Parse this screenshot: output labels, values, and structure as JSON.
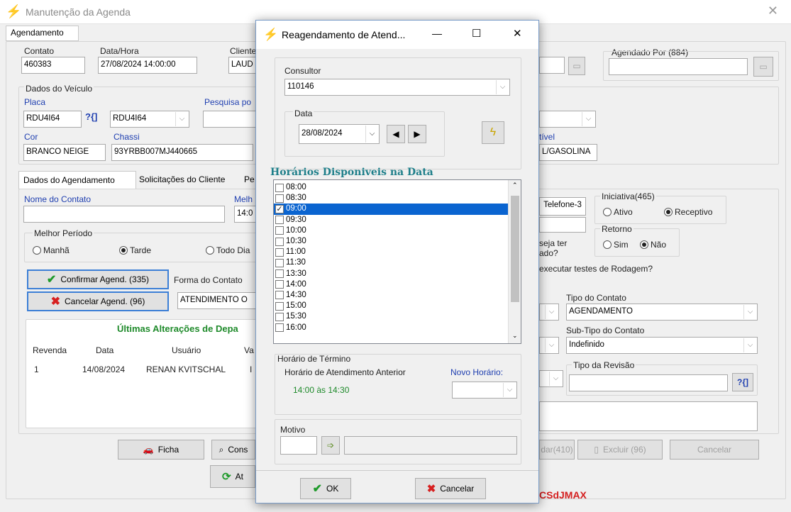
{
  "main": {
    "title": "Manutenção da Agenda",
    "close": "✕",
    "tab": "Agendamento",
    "contato_label": "Contato",
    "contato_value": "460383",
    "datahora_label": "Data/Hora",
    "datahora_value": "27/08/2024 14:00:00",
    "cliente_label": "Cliente",
    "cliente_value": "LAUD",
    "agendado_label": "Agendado Por (884)",
    "agendado_value": "",
    "veiculo_label": "Dados do Veículo",
    "placa_label": "Placa",
    "placa_value": "RDU4I64",
    "placa_combo": "RDU4I64",
    "pesquisa_label": "Pesquisa po",
    "cor_label": "Cor",
    "cor_value": "BRANCO NEIGE",
    "chassi_label": "Chassi",
    "chassi_value": "93YRBB007MJ440665",
    "combustivel_label": "tível",
    "combustivel_value": "L/GASOLINA",
    "subtabs": [
      "Dados do Agendamento",
      "Solicitações do Cliente",
      "Pe"
    ],
    "nome_contato_label": "Nome do Contato",
    "melhor_label": "Melh",
    "melhor_value": "14:0",
    "periodo_label": "Melhor Período",
    "periodo_opts": [
      "Manhã",
      "Tarde",
      "Todo Dia"
    ],
    "confirmar": "Confirmar Agend. (335)",
    "cancelar_agend": "Cancelar Agend. (96)",
    "forma_label": "Forma do Contato",
    "forma_value": "ATENDIMENTO O",
    "ultimas_title": "Últimas Alterações de Depa",
    "grid_headers": [
      "Revenda",
      "Data",
      "Usuário",
      "Va"
    ],
    "grid_row": [
      "1",
      "14/08/2024",
      "RENAN KVITSCHAL",
      "I"
    ],
    "telefone3": "Telefone-3",
    "iniciativa_label": "Iniciativa(465)",
    "iniciativa_opts": [
      "Ativo",
      "Receptivo"
    ],
    "retorno_label": "Retorno",
    "retorno_opts": [
      "Sim",
      "Não"
    ],
    "deseja_text": "seja ter",
    "ado_text": "ado?",
    "testes_text": "executar testes de Rodagem?",
    "tipo_contato_label": "Tipo do Contato",
    "tipo_contato_value": "AGENDAMENTO",
    "subtipo_label": "Sub-Tipo do Contato",
    "subtipo_value": "Indefinido",
    "tipo_revisao_label": "Tipo da Revisão",
    "help_icon": "?{]",
    "ficha": "Ficha",
    "cons": "Cons",
    "at": "At",
    "dar": "dar(410)",
    "excluir": "Excluir (96)",
    "cancelar_btn": "Cancelar",
    "brand": "CSdJMAX"
  },
  "dialog": {
    "title": "Reagendamento de Atend...",
    "minimize": "—",
    "maximize": "☐",
    "close": "✕",
    "consultor_label": "Consultor",
    "consultor_value": "110146",
    "data_label": "Data",
    "data_value": "28/08/2024",
    "horarios_title": "Horários Disponiveis na Data",
    "horarios": [
      "08:00",
      "08:30",
      "09:00",
      "09:30",
      "10:00",
      "10:30",
      "11:00",
      "11:30",
      "13:30",
      "14:00",
      "14:30",
      "15:00",
      "15:30",
      "16:00"
    ],
    "selected_index": 2,
    "termino_label": "Horário de Término",
    "anterior_label": "Horário de Atendimento Anterior",
    "anterior_value": "14:00 às 14:30",
    "novo_label": "Novo Horário:",
    "motivo_label": "Motivo",
    "ok": "OK",
    "cancelar": "Cancelar"
  }
}
